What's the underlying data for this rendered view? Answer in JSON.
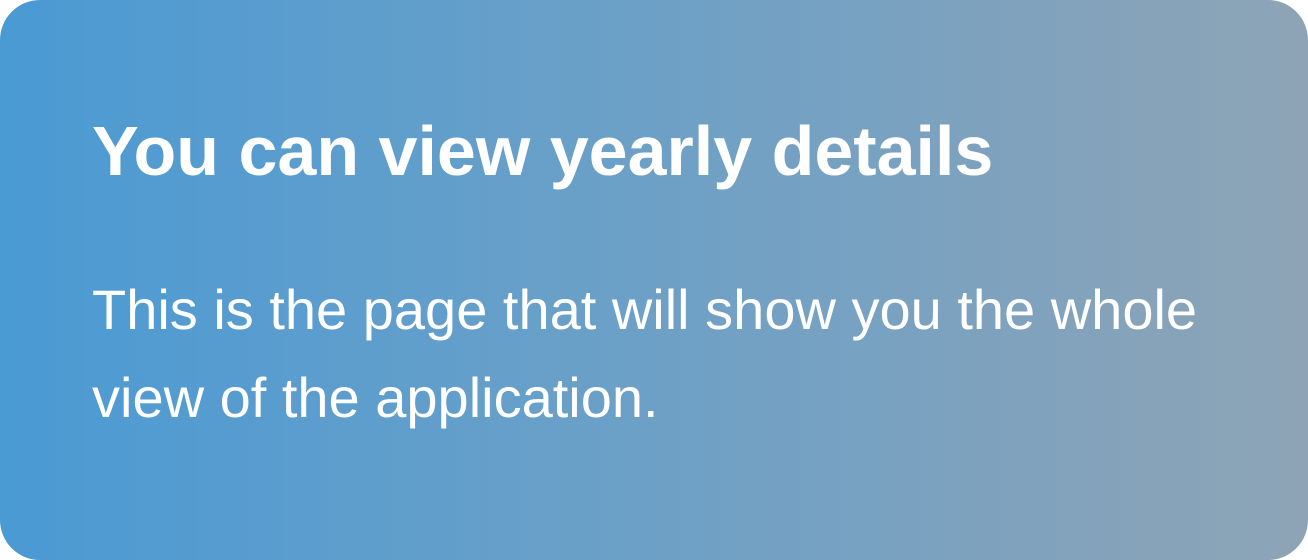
{
  "card": {
    "title": "You can view yearly details",
    "description": "This is the page that will show you the whole view of the application."
  },
  "colors": {
    "gradient_start": "#4a9ad4",
    "gradient_end": "#8ea4b6",
    "text": "#ffffff"
  }
}
